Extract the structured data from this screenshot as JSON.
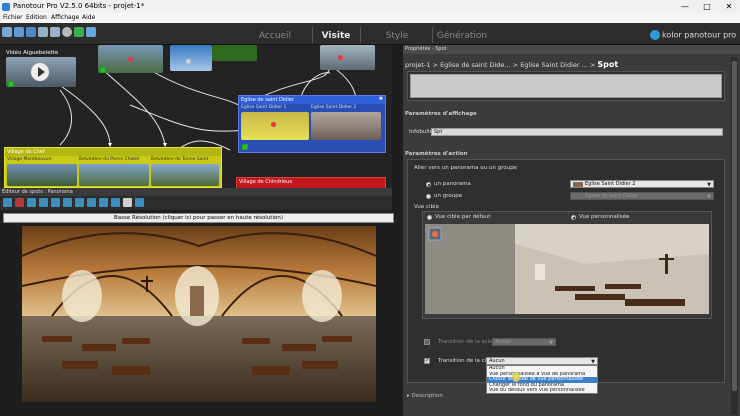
{
  "window": {
    "title": "Panotour Pro V2.5.0 64bits - projet-1*",
    "controls": [
      "minimize-icon",
      "maximize-icon",
      "close-icon"
    ]
  },
  "menu": [
    "Fichier",
    "Edition",
    "Affichage",
    "Aide"
  ],
  "nav": {
    "tabs": [
      "Accueil",
      "Visite",
      "Style",
      "Génération"
    ],
    "active": "Visite",
    "brand": "kolor panotour pro"
  },
  "graph": {
    "video_node": "Vidéo Aiguebelette",
    "card_blue": {
      "title": "Eglise de saint Didier",
      "items": [
        "Eglise Saint Didier 1",
        "Eglise Saint Didier 2"
      ]
    },
    "card_yellow": {
      "title": "Village de Chef",
      "items": [
        "Village Montbeuvon",
        "Belvédère du Pierre Chatel",
        "Belvédère de Tonne Saint"
      ]
    },
    "card_red": {
      "title": "Village de Chindrieux"
    }
  },
  "editor": {
    "header": "Éditeur de spots : Panorama",
    "resolution_button": "Basse Résolution (cliquer ici pour passer en haute résolution)"
  },
  "props": {
    "header": "Propriétés - Spot",
    "breadcrumb": [
      "projet-1",
      "Eglise de saint Dide...",
      "Eglise Saint Didier ..."
    ],
    "breadcrumb_current": "Spot",
    "display_section": "Paramètres d'affichage",
    "infobulle_label": "Infobulle",
    "infobulle_value": "Spt",
    "action_section": "Paramètres d'action",
    "goto_label": "Aller vers un panorama ou un groupe",
    "radio_pano": "un panorama",
    "radio_group": "un groupe",
    "pano_select": "Eglise Saint Didier 2",
    "group_select": "Eglise de saint Didier",
    "view_label": "Vue cible",
    "view_default": "Vue cible par défaut",
    "view_custom": "Vue personnalisée",
    "transition_scene_label": "Transition de la scène",
    "transition_scene_value": "Aucun",
    "transition_view_label": "Transition de la cible",
    "transition_view_value": "Aucun",
    "dropdown_options": [
      "Aucun",
      "Vue personnalisée à vue de panorama",
      "Choisir le mode de vue personnalisée",
      "Changer le fond du panorama",
      "Vue du dessus vers vue personnalisée"
    ],
    "dropdown_selected_index": 2,
    "description_label": "Description"
  },
  "colors": {
    "accent_blue": "#2f6fd6",
    "card_yellow": "#c9c916",
    "card_red": "#c0181c",
    "spot_yellow": "#e0e02a"
  }
}
